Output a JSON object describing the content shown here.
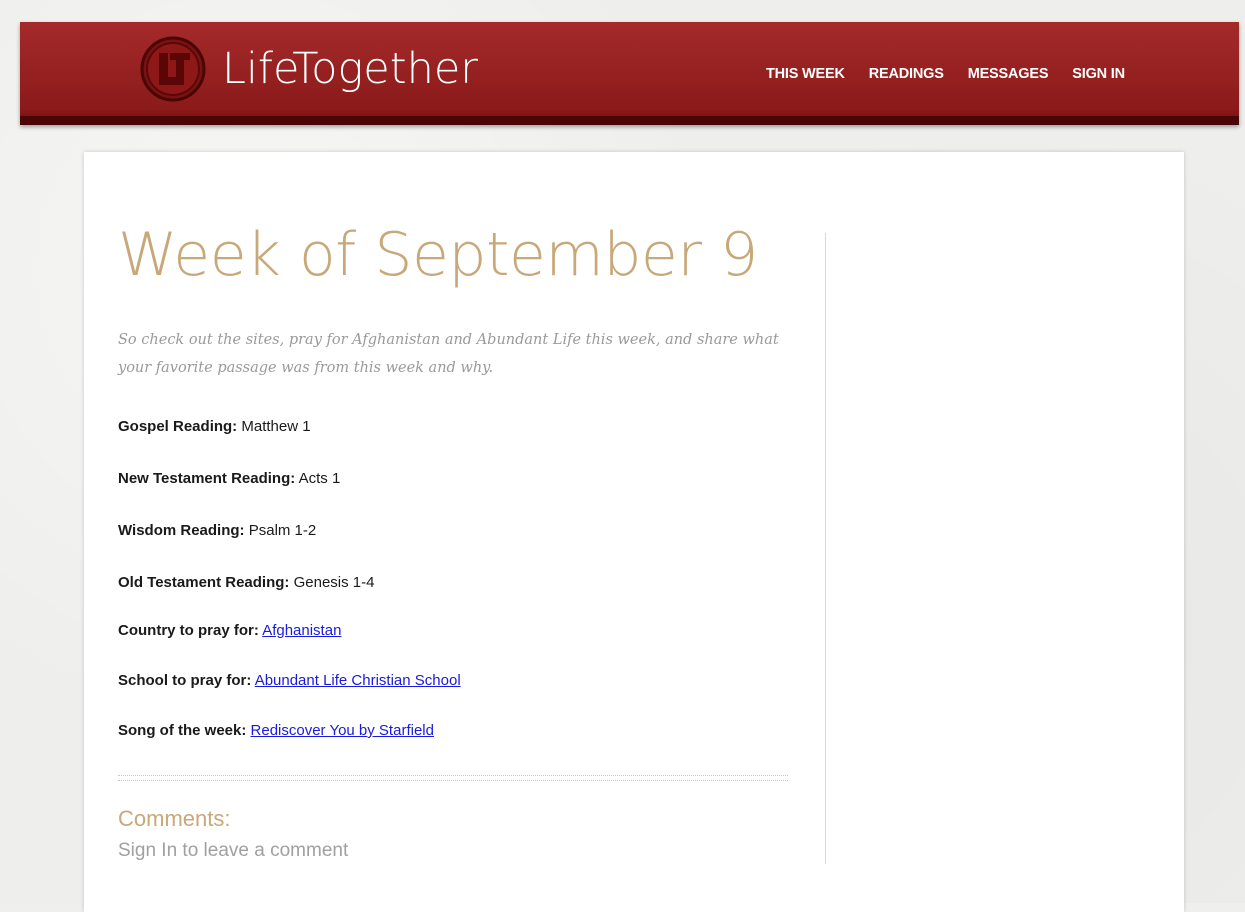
{
  "site": {
    "name": "LifeTogether",
    "logo_icon": "lt-monogram-icon"
  },
  "nav": {
    "items": [
      {
        "label": "THIS WEEK"
      },
      {
        "label": "READINGS"
      },
      {
        "label": "MESSAGES"
      },
      {
        "label": "SIGN IN"
      }
    ]
  },
  "page": {
    "title": "Week of September 9",
    "intro": "So check out the sites, pray for Afghanistan and Abundant Life this week, and share what your favorite passage was from this week and why."
  },
  "readings": [
    {
      "label": "Gospel Reading:",
      "value": "Matthew 1",
      "is_link": false
    },
    {
      "label": "New Testament Reading:",
      "value": "Acts 1",
      "is_link": false
    },
    {
      "label": "Wisdom Reading:",
      "value": "Psalm 1-2",
      "is_link": false
    },
    {
      "label": "Old Testament Reading:",
      "value": "Genesis 1-4",
      "is_link": false
    },
    {
      "label": "Country to pray for:",
      "value": "Afghanistan",
      "is_link": true
    },
    {
      "label": "School to pray for:",
      "value": "Abundant Life Christian School",
      "is_link": true
    },
    {
      "label": "Song of the week:",
      "value": "Rediscover You by Starfield",
      "is_link": true
    }
  ],
  "comments": {
    "title": "Comments:",
    "note": "Sign In to leave a comment"
  },
  "colors": {
    "header_red": "#9b2121",
    "accent_tan": "#c8a878",
    "link_blue": "#1a1adf"
  }
}
